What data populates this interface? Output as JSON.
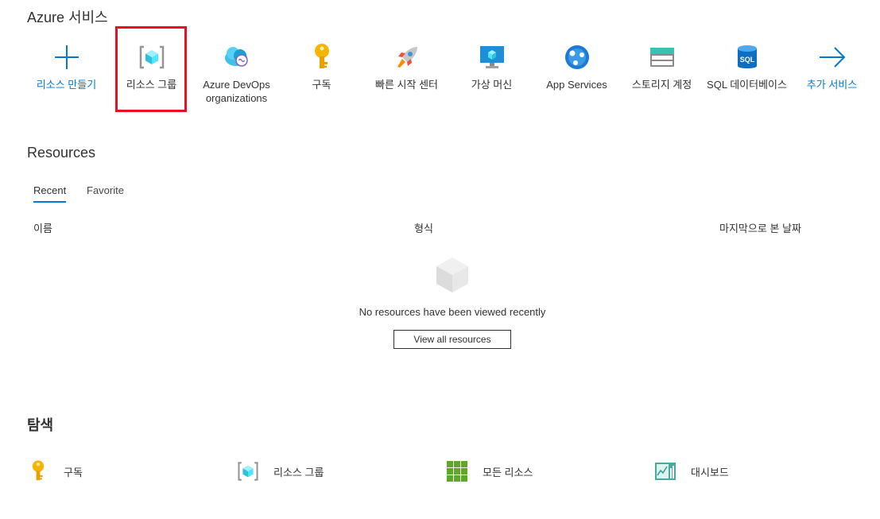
{
  "services_section": {
    "title": "Azure 서비스"
  },
  "services": [
    {
      "label": "리소스 만들기",
      "icon": "plus-icon"
    },
    {
      "label": "리소스 그룹",
      "icon": "resource-group-icon"
    },
    {
      "label": "Azure DevOps organizations",
      "icon": "devops-icon"
    },
    {
      "label": "구독",
      "icon": "key-icon"
    },
    {
      "label": "빠른 시작 센터",
      "icon": "rocket-icon"
    },
    {
      "label": "가상 머신",
      "icon": "vm-icon"
    },
    {
      "label": "App Services",
      "icon": "app-services-icon"
    },
    {
      "label": "스토리지 계정",
      "icon": "storage-icon"
    },
    {
      "label": "SQL 데이터베이스",
      "icon": "sql-icon"
    },
    {
      "label": "추가 서비스",
      "icon": "arrow-right-icon"
    }
  ],
  "resources": {
    "title": "Resources",
    "tabs": {
      "recent": "Recent",
      "favorite": "Favorite"
    },
    "columns": {
      "name": "이름",
      "type": "형식",
      "last_viewed": "마지막으로 본 날짜"
    },
    "empty_message": "No resources have been viewed recently",
    "view_all_label": "View all resources"
  },
  "explore": {
    "title": "탐색",
    "items": [
      {
        "label": "구독",
        "icon": "key-icon"
      },
      {
        "label": "리소스 그룹",
        "icon": "resource-group-icon"
      },
      {
        "label": "모든 리소스",
        "icon": "grid-icon"
      },
      {
        "label": "대시보드",
        "icon": "dashboard-icon"
      }
    ]
  },
  "colors": {
    "accent": "#0078d4",
    "highlight": "#e81123",
    "key": "#f4b400",
    "grid": "#5ea829"
  }
}
